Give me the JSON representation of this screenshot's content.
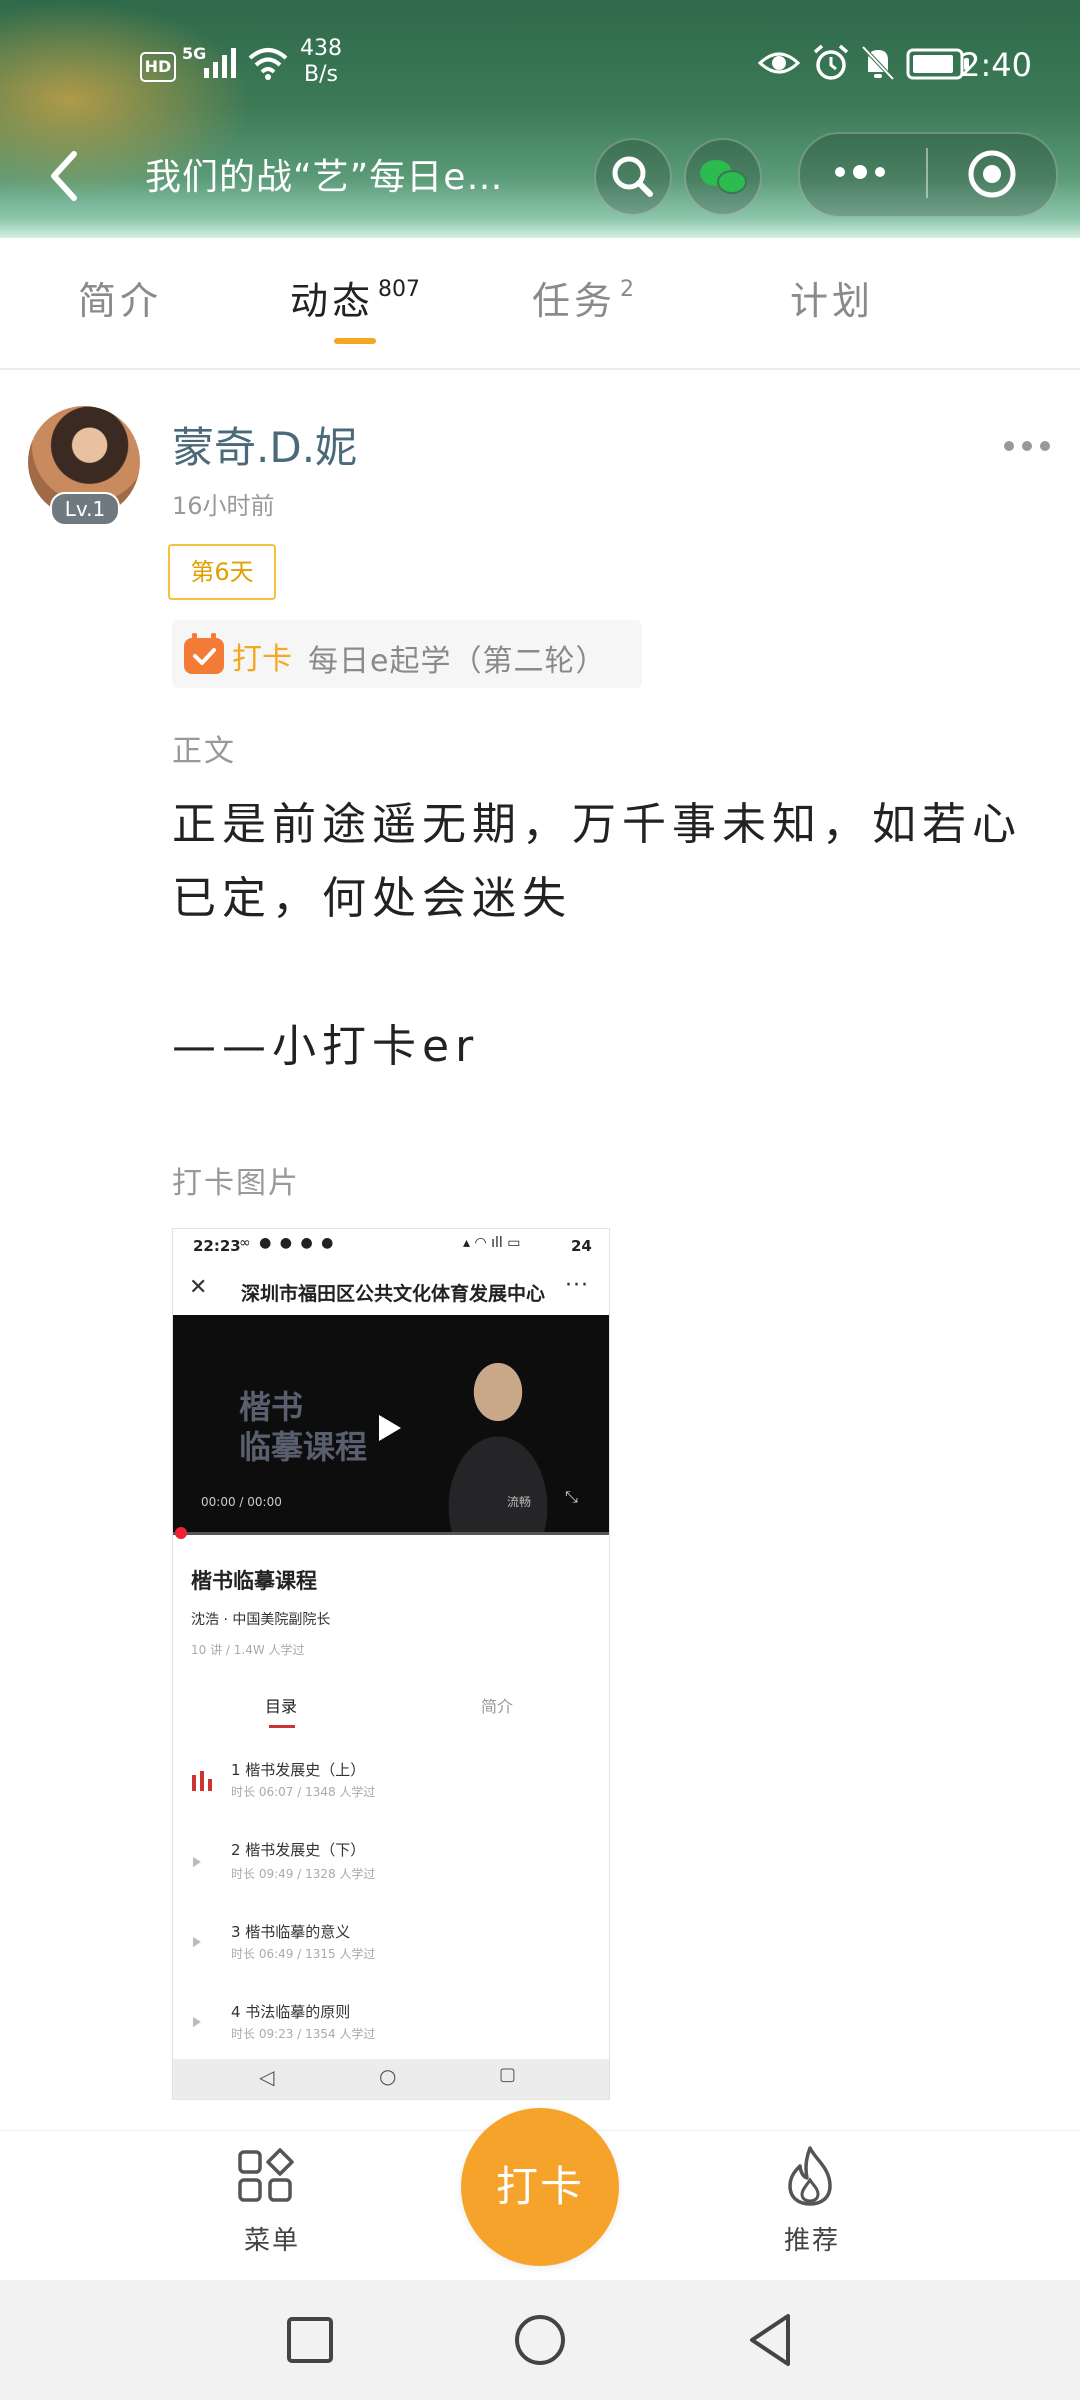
{
  "status_bar": {
    "hd": "HD",
    "network": "5G",
    "speed_value": "438",
    "speed_unit": "B/s",
    "time": "2:40"
  },
  "titlebar": {
    "title": "我们的战“艺”每日e…"
  },
  "tabs": [
    {
      "label": "简介",
      "badge": ""
    },
    {
      "label": "动态",
      "badge": "807"
    },
    {
      "label": "任务",
      "badge": "2"
    },
    {
      "label": "计划",
      "badge": ""
    }
  ],
  "post": {
    "level": "Lv.1",
    "username": "蒙奇.D.妮",
    "time_ago": "16小时前",
    "day_badge": "第6天",
    "checkin_word": "打卡",
    "checkin_name": "每日e起学（第二轮）",
    "body_label": "正文",
    "body_text": "正是前途遥无期，万千事未知，如若心已定，何处会迷失\n\n——小打卡er",
    "image_label": "打卡图片"
  },
  "screenshot": {
    "time": "22:23",
    "battery": "24",
    "title": "深圳市福田区公共文化体育发展中心",
    "video_title_line1": "楷书",
    "video_title_line2": "临摹课程",
    "timecode": "00:00 / 00:00",
    "watermark": "流畅",
    "course_title": "楷书临摹课程",
    "teacher": "沈浩 · 中国美院副院长",
    "meta": "10 讲 / 1.4W 人学过",
    "tab_catalog": "目录",
    "tab_intro": "简介",
    "items": [
      {
        "title": "1 楷书发展史（上）",
        "sub": "时长 06:07 / 1348 人学过"
      },
      {
        "title": "2 楷书发展史（下）",
        "sub": "时长 09:49 / 1328 人学过"
      },
      {
        "title": "3 楷书临摹的意义",
        "sub": "时长 06:49 / 1315 人学过"
      },
      {
        "title": "4 书法临摹的原则",
        "sub": "时长 09:23 / 1354 人学过"
      }
    ]
  },
  "bottom_bar": {
    "menu_label": "菜单",
    "checkin_label": "打卡",
    "recommend_label": "推荐"
  }
}
